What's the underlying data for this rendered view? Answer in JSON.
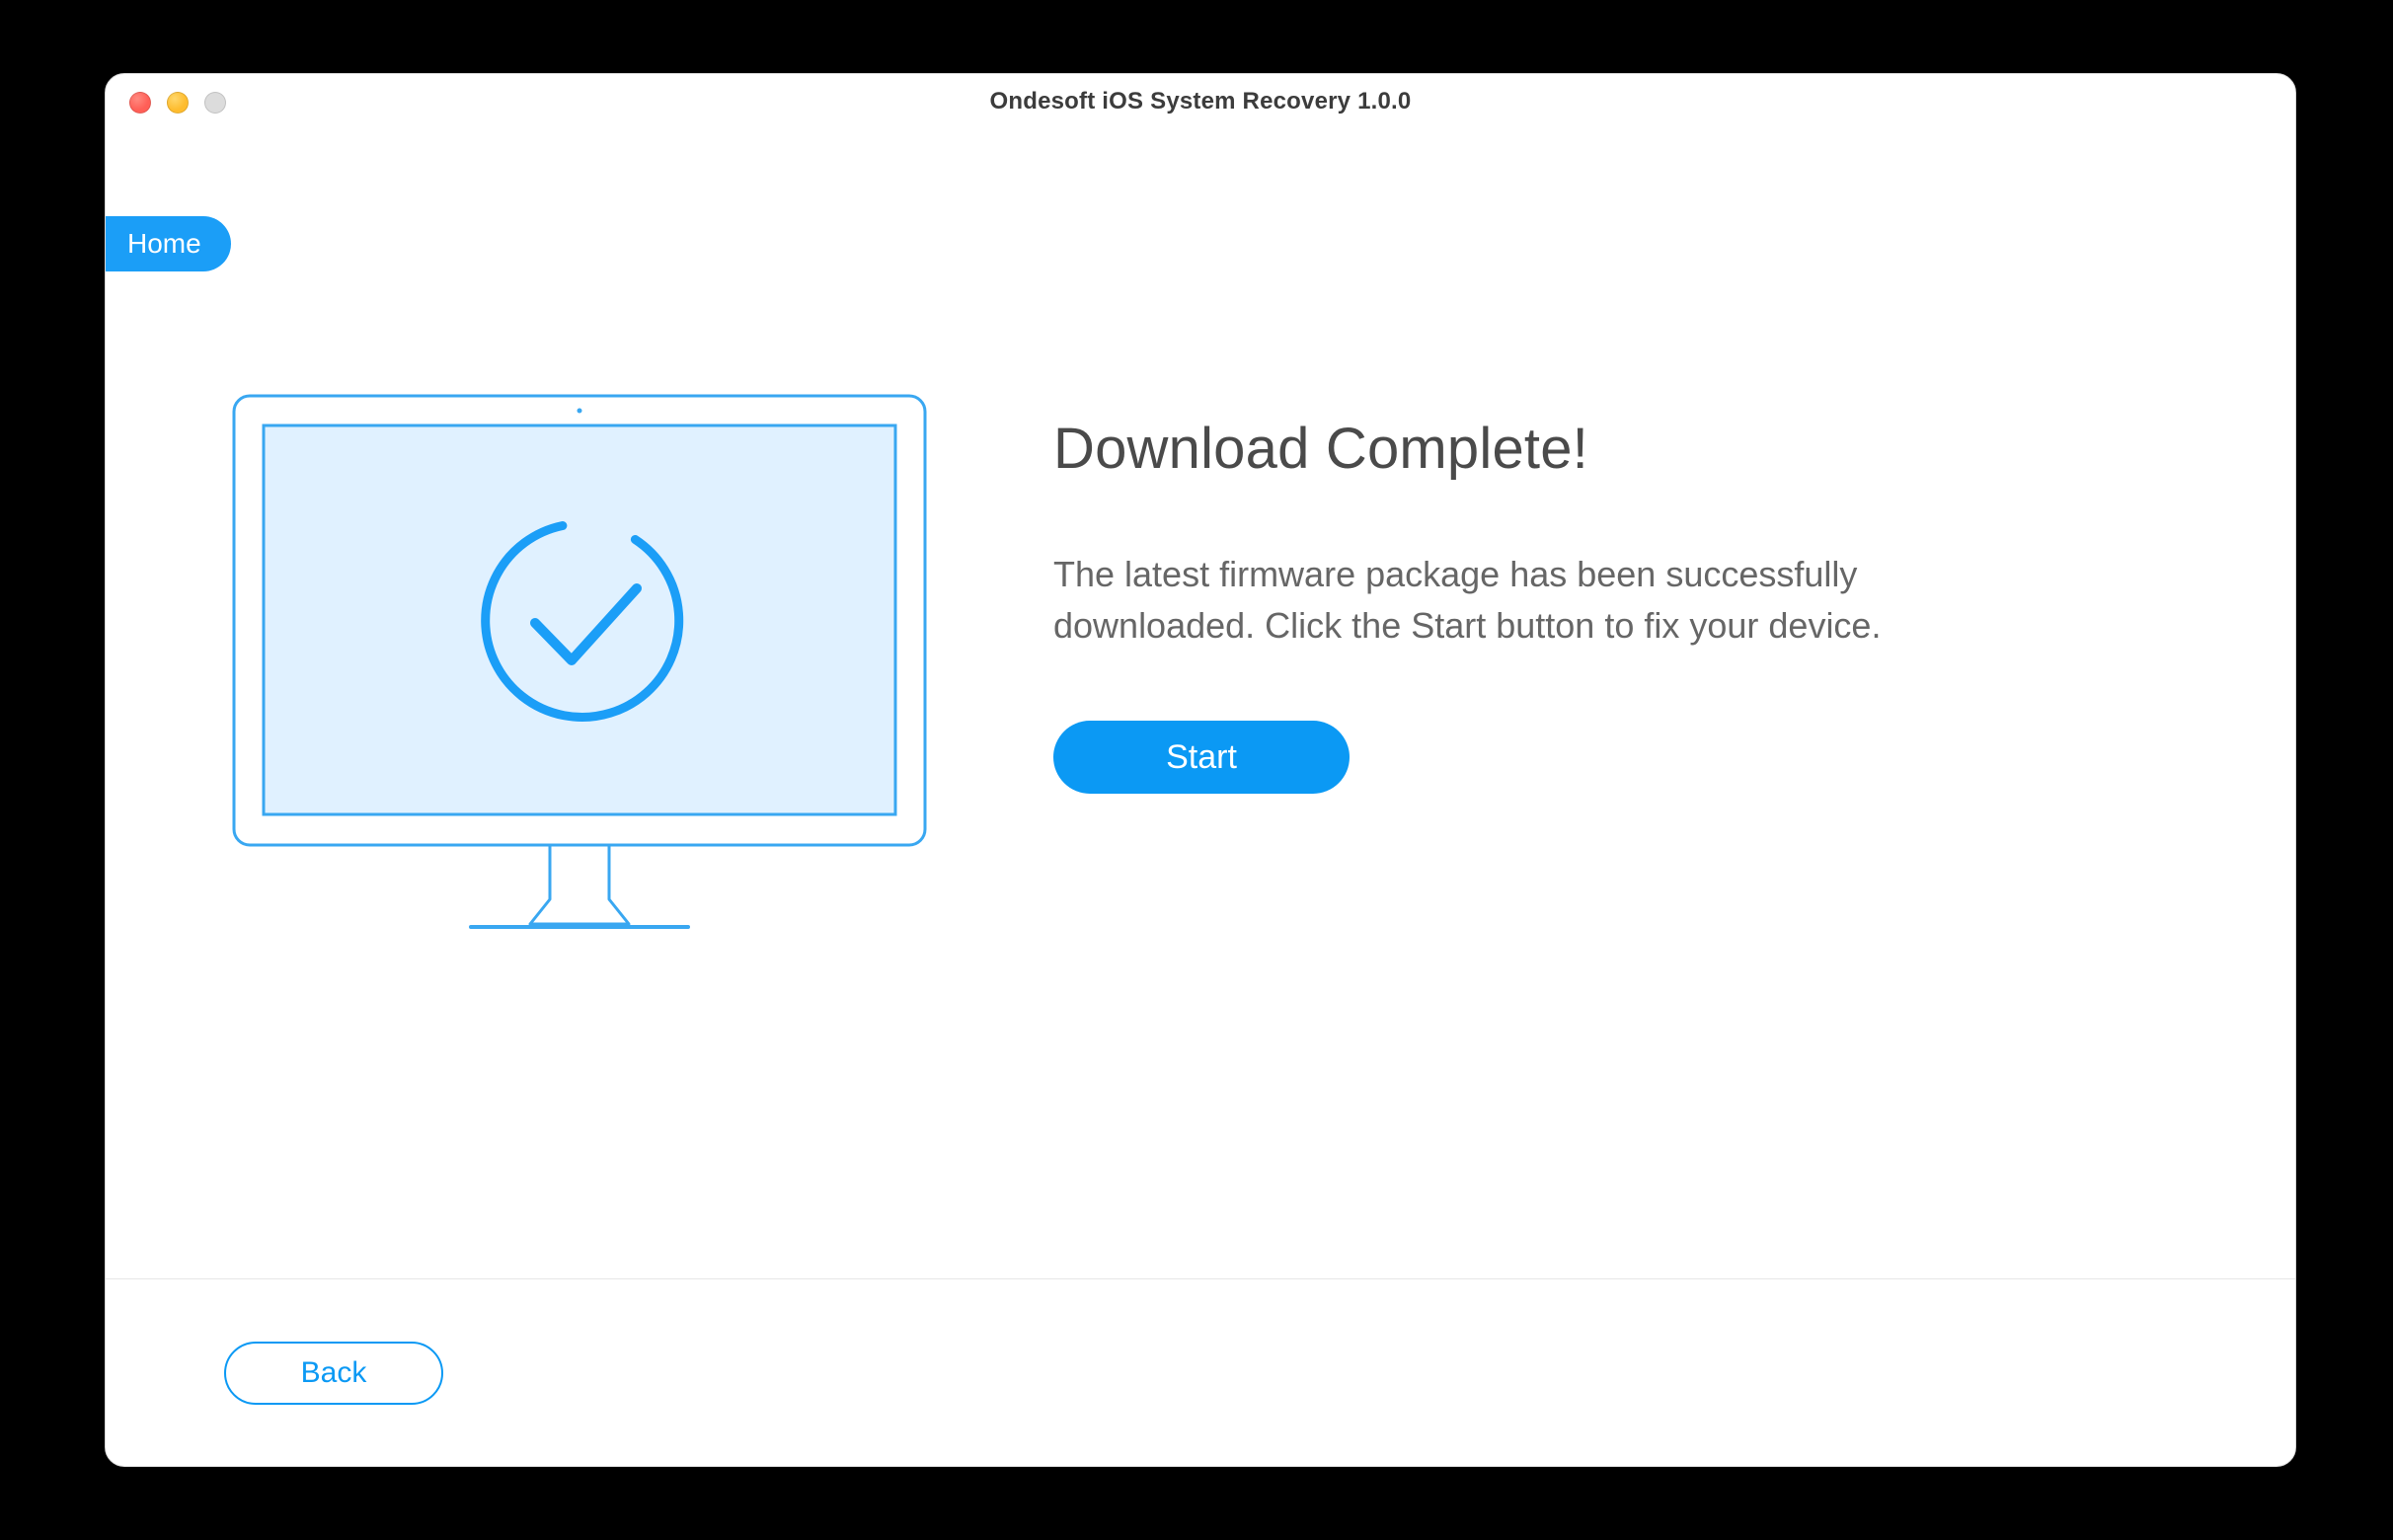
{
  "window": {
    "title": "Ondesoft iOS System Recovery 1.0.0"
  },
  "breadcrumb": {
    "home_label": "Home"
  },
  "main": {
    "heading": "Download Complete!",
    "body": "The latest firmware package has been successfully downloaded. Click the Start button to fix your device.",
    "start_label": "Start"
  },
  "footer": {
    "back_label": "Back"
  },
  "colors": {
    "accent": "#0b99f4"
  }
}
